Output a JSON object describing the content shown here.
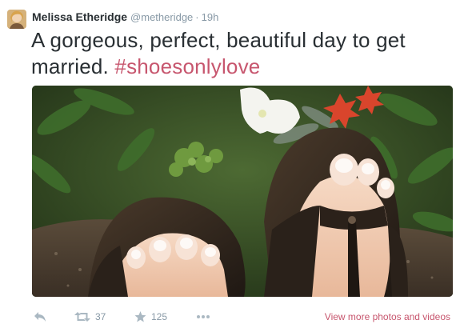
{
  "tweet": {
    "display_name": "Melissa Etheridge",
    "handle": "@metheridge",
    "separator": "·",
    "timestamp": "19h",
    "text_plain": "A gorgeous, perfect, beautiful day to get married.",
    "hashtag": "#shoesonlylove",
    "accent_color": "#c7566e"
  },
  "actions": {
    "reply_icon": "reply-icon",
    "retweet_icon": "retweet-icon",
    "retweet_count": "37",
    "favorite_icon": "star-icon",
    "favorite_count": "125",
    "more_icon": "more-dots-icon",
    "view_more_label": "View more photos and videos"
  }
}
